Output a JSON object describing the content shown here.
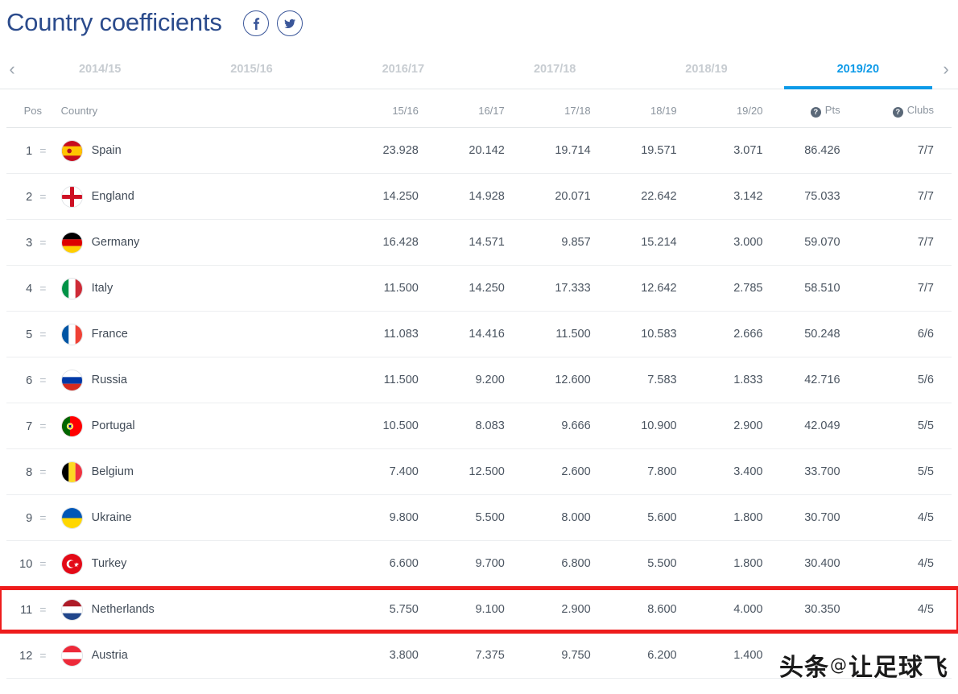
{
  "header": {
    "title": "Country coefficients",
    "social": [
      {
        "name": "facebook-icon",
        "glyph": "f"
      },
      {
        "name": "twitter-icon",
        "glyph": "t"
      }
    ]
  },
  "season_nav": {
    "prev_label": "‹",
    "next_label": "›",
    "active_season": "2019/20",
    "tabs": [
      {
        "label": "2014/15",
        "active": false
      },
      {
        "label": "2015/16",
        "active": false
      },
      {
        "label": "2016/17",
        "active": false
      },
      {
        "label": "2017/18",
        "active": false
      },
      {
        "label": "2018/19",
        "active": false
      },
      {
        "label": "2019/20",
        "active": true
      }
    ]
  },
  "table": {
    "columns": {
      "pos": "Pos",
      "country": "Country",
      "s1": "15/16",
      "s2": "16/17",
      "s3": "17/18",
      "s4": "18/19",
      "s5": "19/20",
      "pts": "Pts",
      "clubs": "Clubs",
      "help_glyph": "?"
    },
    "rows": [
      {
        "pos": "1",
        "trend": "=",
        "country": "Spain",
        "flag": "es",
        "s1": "23.928",
        "s2": "20.142",
        "s3": "19.714",
        "s4": "19.571",
        "s5": "3.071",
        "pts": "86.426",
        "clubs": "7/7",
        "highlighted": false
      },
      {
        "pos": "2",
        "trend": "=",
        "country": "England",
        "flag": "en",
        "s1": "14.250",
        "s2": "14.928",
        "s3": "20.071",
        "s4": "22.642",
        "s5": "3.142",
        "pts": "75.033",
        "clubs": "7/7",
        "highlighted": false
      },
      {
        "pos": "3",
        "trend": "=",
        "country": "Germany",
        "flag": "de",
        "s1": "16.428",
        "s2": "14.571",
        "s3": "9.857",
        "s4": "15.214",
        "s5": "3.000",
        "pts": "59.070",
        "clubs": "7/7",
        "highlighted": false
      },
      {
        "pos": "4",
        "trend": "=",
        "country": "Italy",
        "flag": "it",
        "s1": "11.500",
        "s2": "14.250",
        "s3": "17.333",
        "s4": "12.642",
        "s5": "2.785",
        "pts": "58.510",
        "clubs": "7/7",
        "highlighted": false
      },
      {
        "pos": "5",
        "trend": "=",
        "country": "France",
        "flag": "fr",
        "s1": "11.083",
        "s2": "14.416",
        "s3": "11.500",
        "s4": "10.583",
        "s5": "2.666",
        "pts": "50.248",
        "clubs": "6/6",
        "highlighted": false
      },
      {
        "pos": "6",
        "trend": "=",
        "country": "Russia",
        "flag": "ru",
        "s1": "11.500",
        "s2": "9.200",
        "s3": "12.600",
        "s4": "7.583",
        "s5": "1.833",
        "pts": "42.716",
        "clubs": "5/6",
        "highlighted": false
      },
      {
        "pos": "7",
        "trend": "=",
        "country": "Portugal",
        "flag": "pt",
        "s1": "10.500",
        "s2": "8.083",
        "s3": "9.666",
        "s4": "10.900",
        "s5": "2.900",
        "pts": "42.049",
        "clubs": "5/5",
        "highlighted": false
      },
      {
        "pos": "8",
        "trend": "=",
        "country": "Belgium",
        "flag": "be",
        "s1": "7.400",
        "s2": "12.500",
        "s3": "2.600",
        "s4": "7.800",
        "s5": "3.400",
        "pts": "33.700",
        "clubs": "5/5",
        "highlighted": false
      },
      {
        "pos": "9",
        "trend": "=",
        "country": "Ukraine",
        "flag": "ua",
        "s1": "9.800",
        "s2": "5.500",
        "s3": "8.000",
        "s4": "5.600",
        "s5": "1.800",
        "pts": "30.700",
        "clubs": "4/5",
        "highlighted": false
      },
      {
        "pos": "10",
        "trend": "=",
        "country": "Turkey",
        "flag": "tr",
        "s1": "6.600",
        "s2": "9.700",
        "s3": "6.800",
        "s4": "5.500",
        "s5": "1.800",
        "pts": "30.400",
        "clubs": "4/5",
        "highlighted": false
      },
      {
        "pos": "11",
        "trend": "=",
        "country": "Netherlands",
        "flag": "nl",
        "s1": "5.750",
        "s2": "9.100",
        "s3": "2.900",
        "s4": "8.600",
        "s5": "4.000",
        "pts": "30.350",
        "clubs": "4/5",
        "highlighted": true
      },
      {
        "pos": "12",
        "trend": "=",
        "country": "Austria",
        "flag": "at",
        "s1": "3.800",
        "s2": "7.375",
        "s3": "9.750",
        "s4": "6.200",
        "s5": "1.400",
        "pts": "",
        "clubs": "",
        "highlighted": false
      }
    ]
  },
  "watermark": {
    "prefix": "头条",
    "at": "@",
    "suffix": "让足球飞"
  },
  "colors": {
    "title": "#2b4b8c",
    "active_tab": "#0d9ae8",
    "inactive_tab": "#c7ccd1",
    "highlight_border": "#ee1c1c",
    "text": "#4a5460"
  }
}
